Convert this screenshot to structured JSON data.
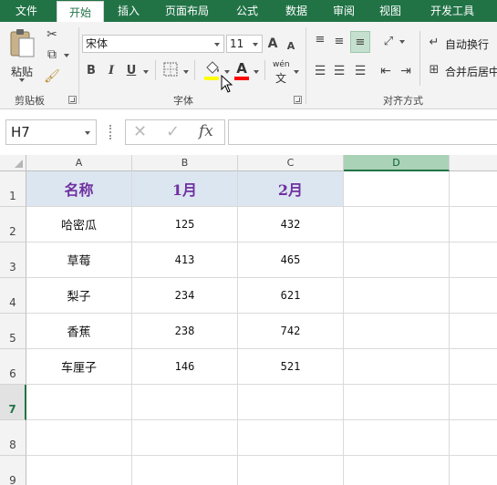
{
  "tabs": [
    "文件",
    "开始",
    "插入",
    "页面布局",
    "公式",
    "数据",
    "审阅",
    "视图",
    "开发工具"
  ],
  "active_tab": "开始",
  "ribbon": {
    "clipboard": {
      "paste_label": "粘贴",
      "group_label": "剪贴板"
    },
    "font": {
      "font_name": "宋体",
      "font_size": "11",
      "bold": "B",
      "italic": "I",
      "underline": "U",
      "grow": "A",
      "shrink": "A",
      "font_color": "A",
      "phonetic": "wén",
      "group_label": "字体",
      "highlight_color": "#ffff00",
      "font_color_hex": "#ff0000"
    },
    "alignment": {
      "wrap_text": "自动换行",
      "merge_center": "合并后居中",
      "group_label": "对齐方式"
    }
  },
  "formula_bar": {
    "name_box": "H7",
    "cancel_icon": "✕",
    "enter_icon": "✓",
    "fx_label": "fx",
    "formula": ""
  },
  "sheet": {
    "columns": [
      "A",
      "B",
      "C",
      "D"
    ],
    "selected_column": "D",
    "rows": [
      "1",
      "2",
      "3",
      "4",
      "5",
      "6",
      "7",
      "8",
      "9"
    ],
    "selected_row": "7",
    "header": [
      "名称",
      "1月",
      "2月"
    ],
    "data": [
      [
        "哈密瓜",
        "125",
        "432"
      ],
      [
        "草莓",
        "413",
        "465"
      ],
      [
        "梨子",
        "234",
        "621"
      ],
      [
        "香蕉",
        "238",
        "742"
      ],
      [
        "车厘子",
        "146",
        "521"
      ]
    ]
  },
  "colors": {
    "brand": "#217346",
    "header_fill": "#dce6f1",
    "header_text": "#7030a0"
  }
}
